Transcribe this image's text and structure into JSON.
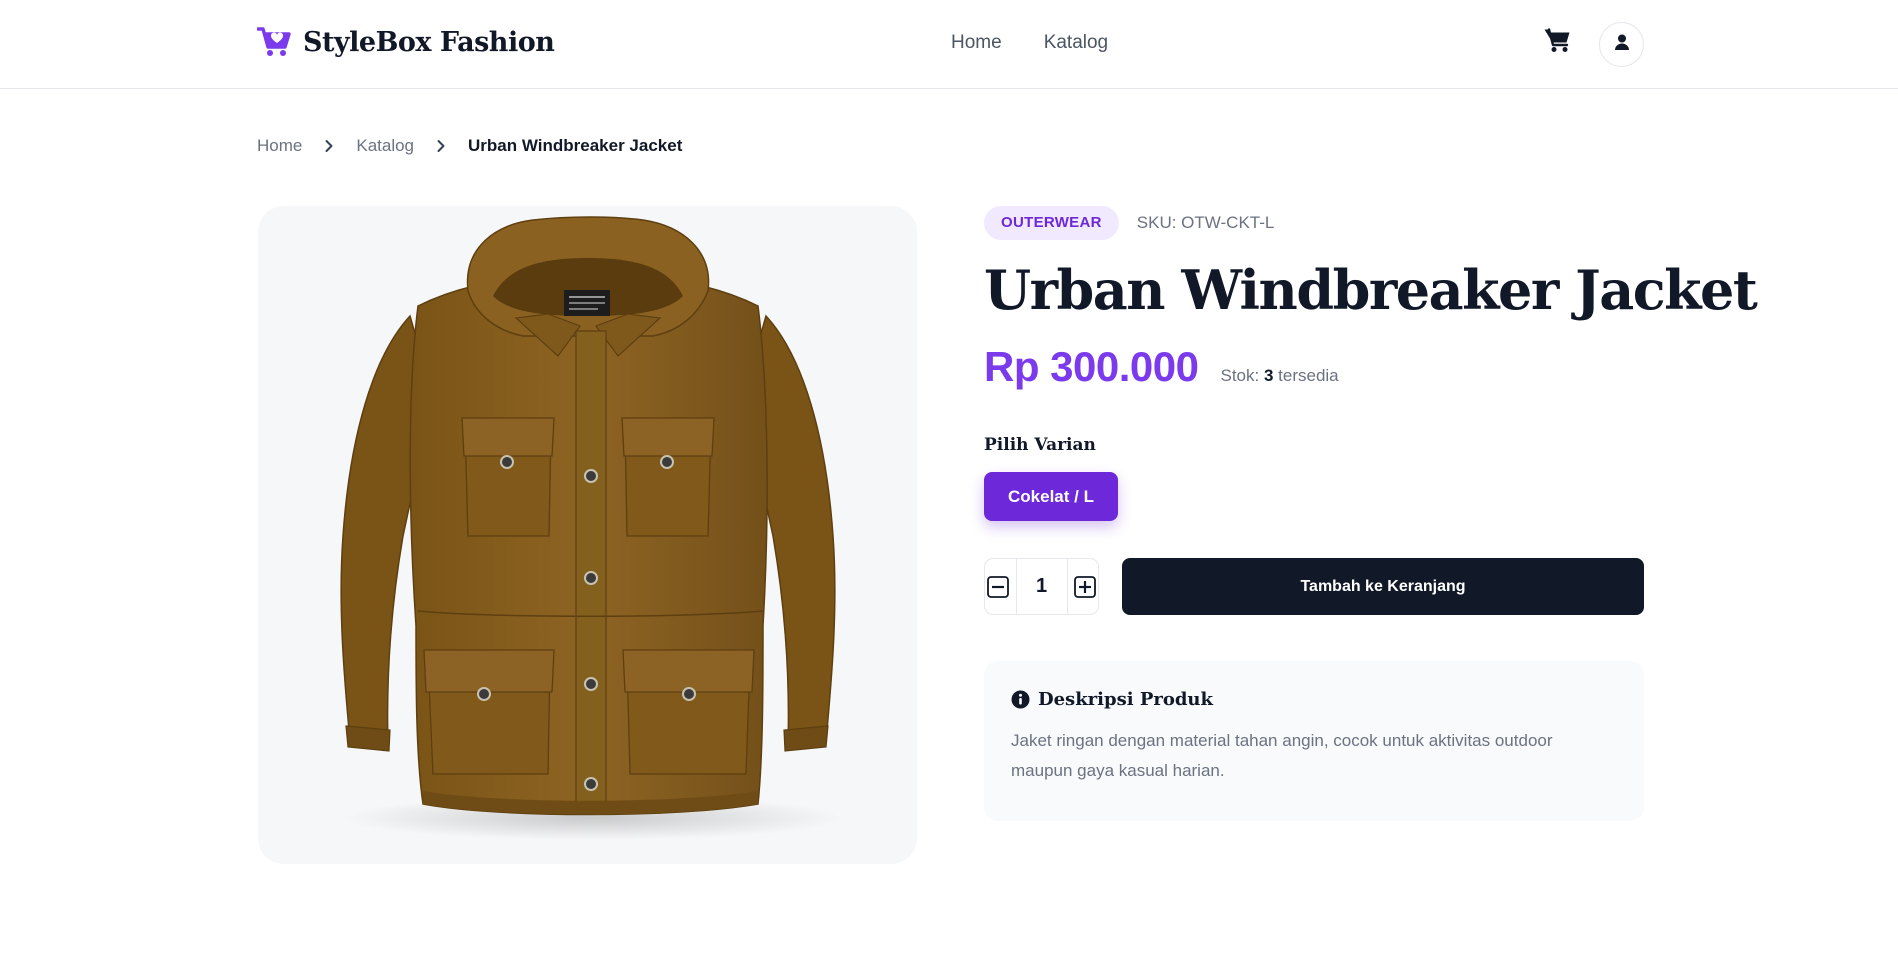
{
  "header": {
    "brand_name": "StyleBox Fashion",
    "nav": [
      {
        "label": "Home"
      },
      {
        "label": "Katalog"
      }
    ],
    "icons": {
      "brand": "shopping-cart-heart-icon",
      "cart": "shopping-cart-icon",
      "account": "user-icon"
    }
  },
  "breadcrumb": {
    "items": [
      {
        "label": "Home"
      },
      {
        "label": "Katalog"
      }
    ],
    "current": "Urban Windbreaker Jacket"
  },
  "product": {
    "category": "OUTERWEAR",
    "sku": "SKU: OTW-CKT-L",
    "title": "Urban Windbreaker Jacket",
    "price": "Rp 300.000",
    "stock_prefix": "Stok: ",
    "stock_count": "3",
    "stock_suffix": " tersedia",
    "variant_label": "Pilih Varian",
    "variants": [
      {
        "label": "Cokelat / L",
        "selected": true
      }
    ],
    "quantity": "1",
    "add_to_cart_label": "Tambah ke Keranjang",
    "description_title": "Deskripsi Produk",
    "description_text": "Jaket ringan dengan material tahan angin, cocok untuk aktivitas outdoor maupun gaya kasual harian.",
    "image_subject": "brown hooded field jacket"
  },
  "colors": {
    "accent": "#6d28d9",
    "price": "#7c3aed",
    "dark_button": "#111827",
    "badge_bg": "#f1eafe"
  }
}
